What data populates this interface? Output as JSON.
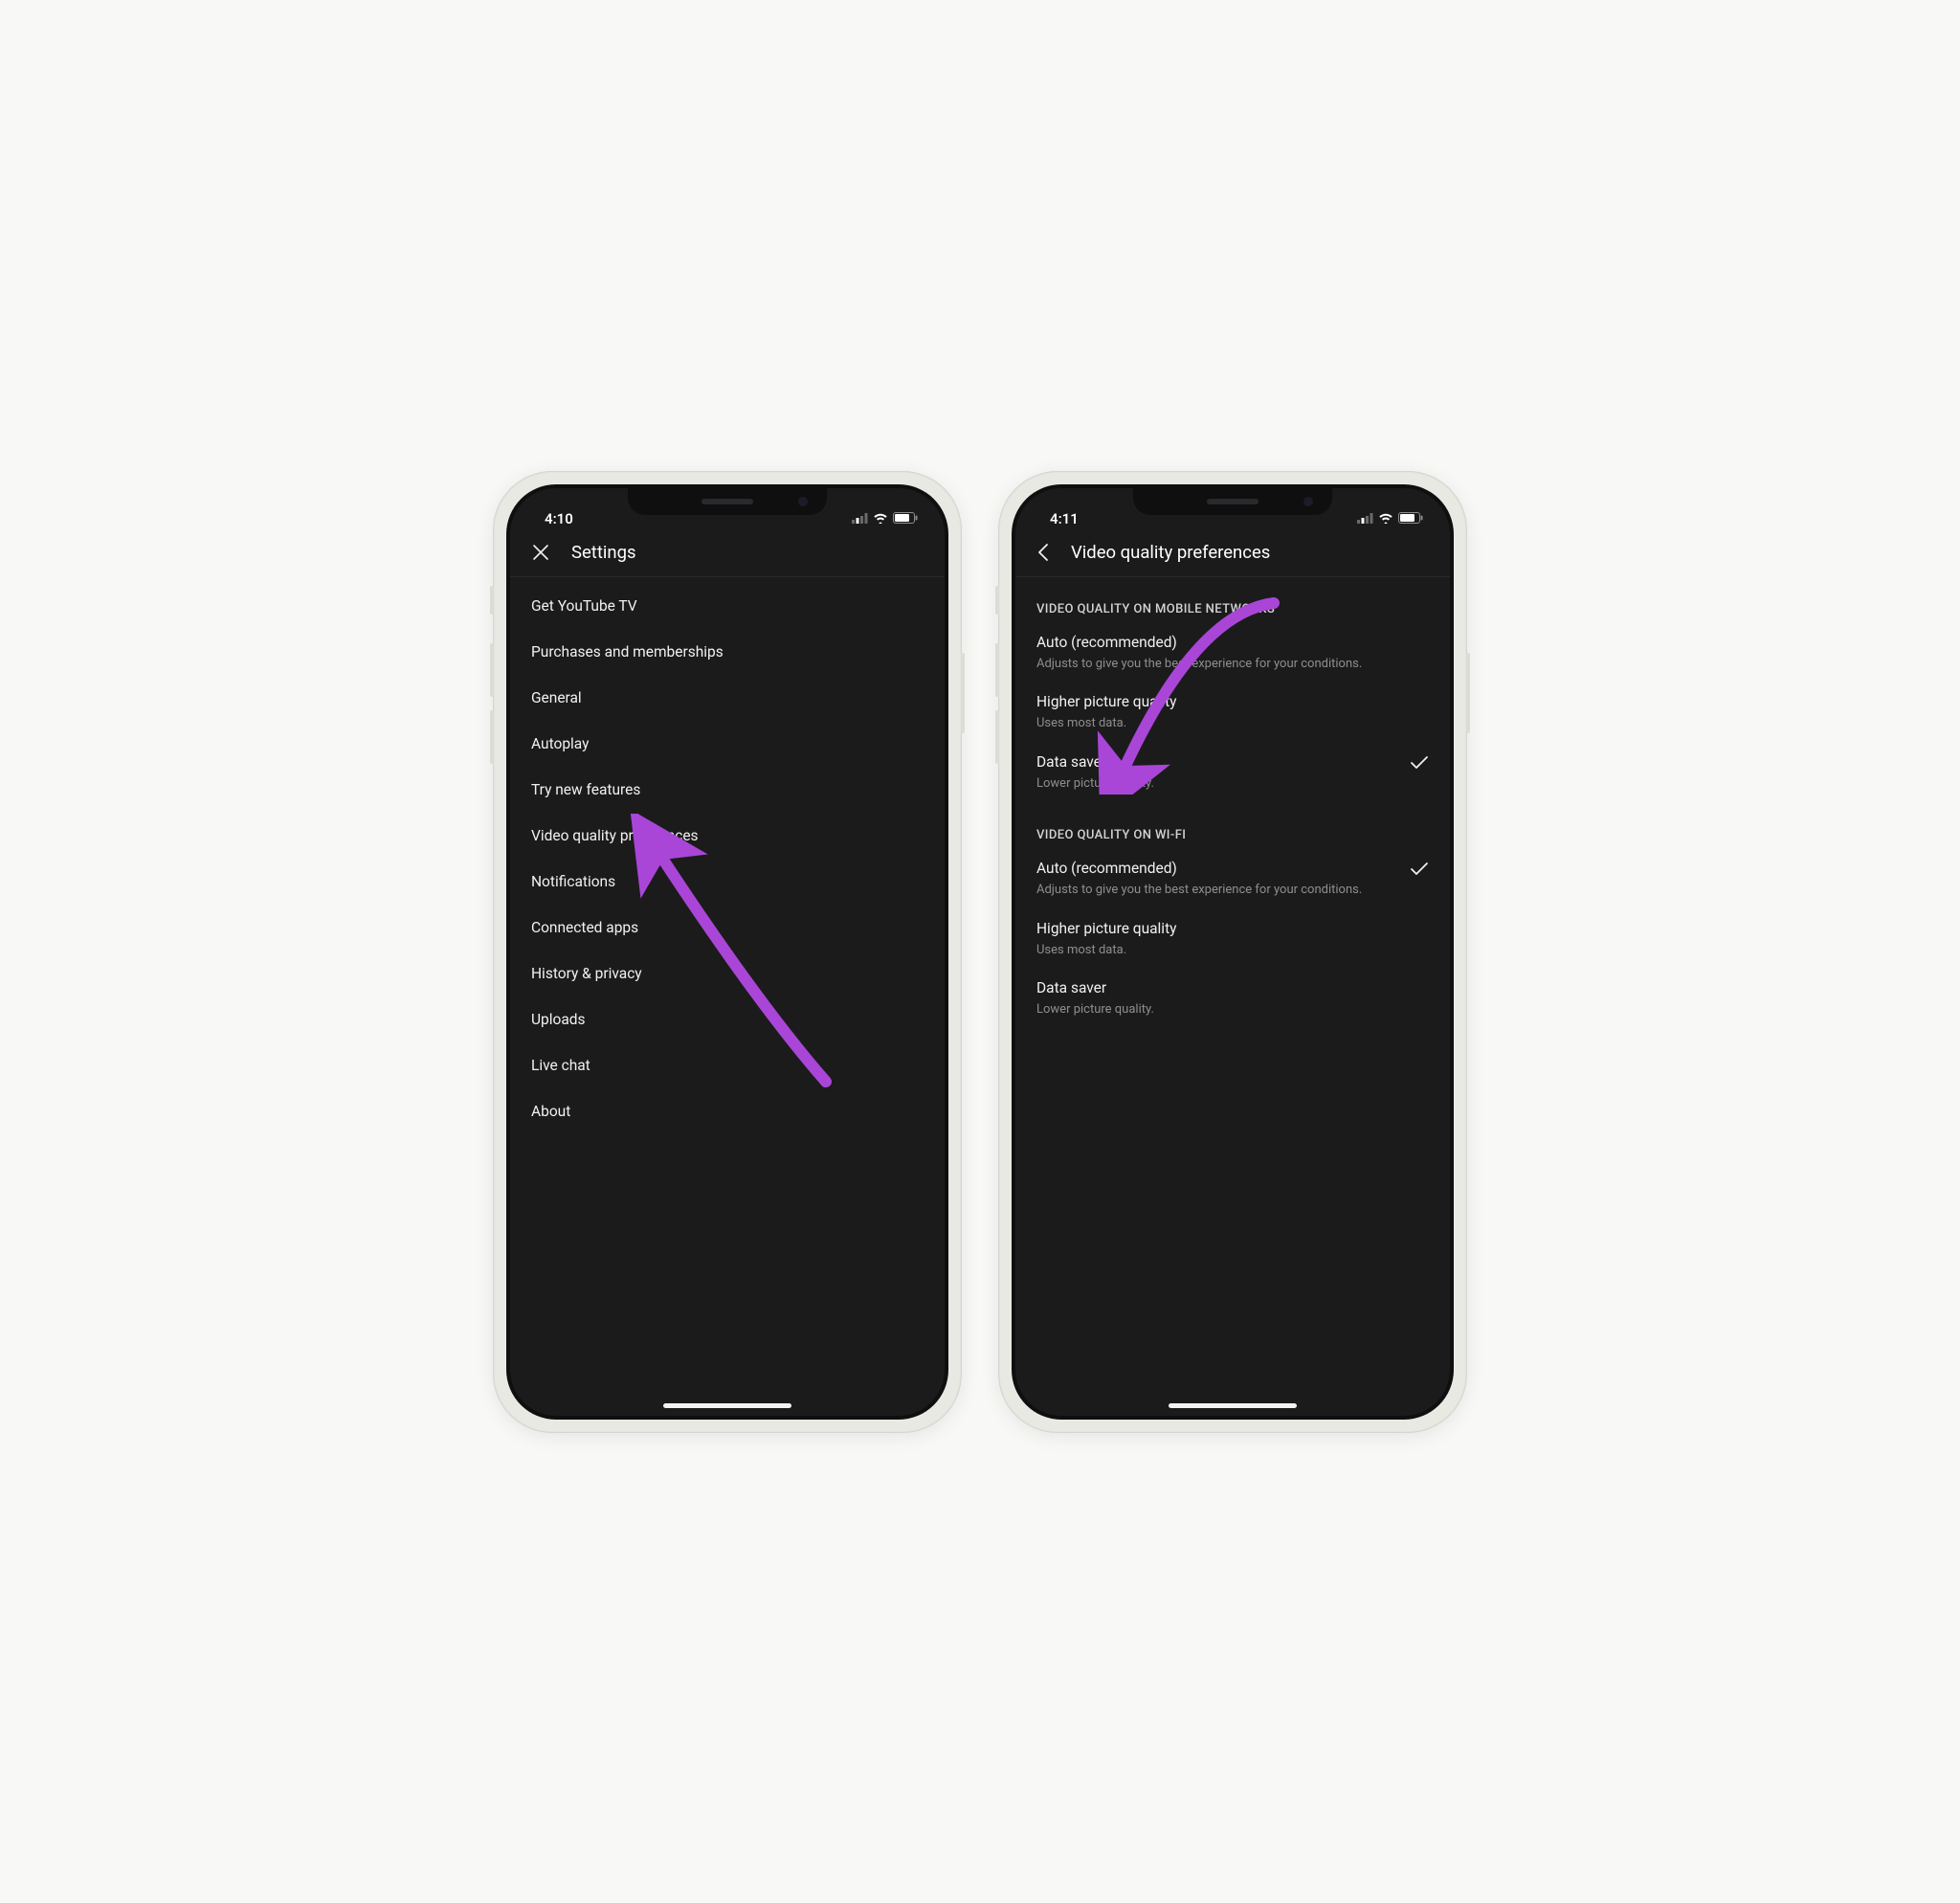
{
  "annotation_color": "#a946d8",
  "left": {
    "time": "4:10",
    "header_title": "Settings",
    "items": [
      "Get YouTube TV",
      "Purchases and memberships",
      "General",
      "Autoplay",
      "Try new features",
      "Video quality preferences",
      "Notifications",
      "Connected apps",
      "History & privacy",
      "Uploads",
      "Live chat",
      "About"
    ]
  },
  "right": {
    "time": "4:11",
    "header_title": "Video quality preferences",
    "sections": [
      {
        "header": "VIDEO QUALITY ON MOBILE NETWORKS",
        "options": [
          {
            "title": "Auto (recommended)",
            "sub": "Adjusts to give you the best experience for your conditions.",
            "selected": false
          },
          {
            "title": "Higher picture quality",
            "sub": "Uses most data.",
            "selected": false
          },
          {
            "title": "Data saver",
            "sub": "Lower picture quality.",
            "selected": true
          }
        ]
      },
      {
        "header": "VIDEO QUALITY ON WI-FI",
        "options": [
          {
            "title": "Auto (recommended)",
            "sub": "Adjusts to give you the best experience for your conditions.",
            "selected": true
          },
          {
            "title": "Higher picture quality",
            "sub": "Uses most data.",
            "selected": false
          },
          {
            "title": "Data saver",
            "sub": "Lower picture quality.",
            "selected": false
          }
        ]
      }
    ]
  }
}
